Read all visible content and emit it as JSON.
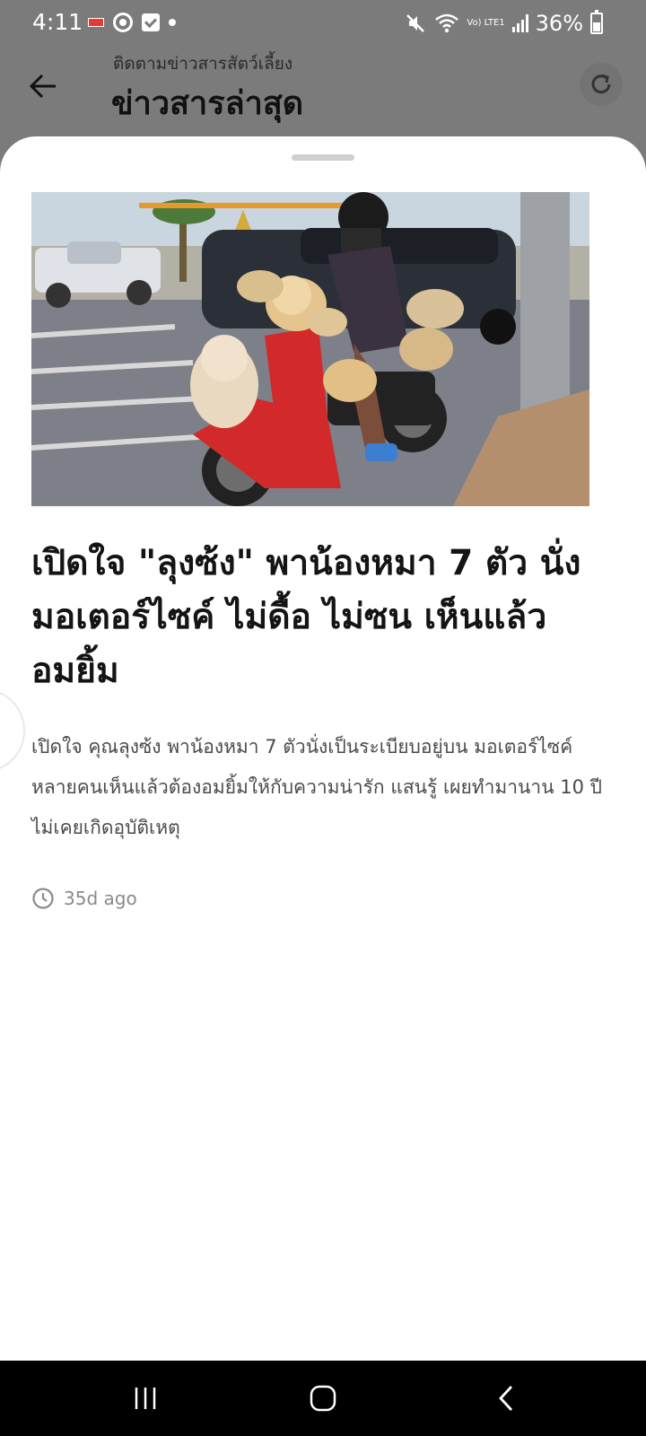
{
  "status_bar": {
    "time": "4:11",
    "battery": "36%",
    "network": "Vo) LTE1"
  },
  "header": {
    "subtitle": "ติดตามข่าวสารสัตว์เลี้ยง",
    "title": "ข่าวสารล่าสุด",
    "back_icon": "arrow-left-icon",
    "refresh_icon": "refresh-icon"
  },
  "article": {
    "image_alt": "man-riding-motorcycle-with-dogs-photo",
    "title": "เปิดใจ \"ลุงซ้ง\" พาน้องหมา 7 ตัว นั่งมอเตอร์ไซค์ ไม่ดื้อ ไม่ซน เห็นแล้วอมยิ้ม",
    "summary": "เปิดใจ คุณลุงซ้ง พาน้องหมา 7 ตัวนั่งเป็นระเบียบอยู่บน มอเตอร์ไซค์ หลายคนเห็นแล้วต้องอมยิ้มให้กับความน่ารัก แสนรู้ เผยทำมานาน 10 ปี ไม่เคยเกิดอุบัติเหตุ",
    "time_ago": "35d ago"
  },
  "colors": {
    "dim_overlay": "#7b7b7b",
    "sheet": "#ffffff",
    "title_text": "#141414",
    "summary_text": "#4a4a4a",
    "meta_text": "#8a8a8a"
  }
}
